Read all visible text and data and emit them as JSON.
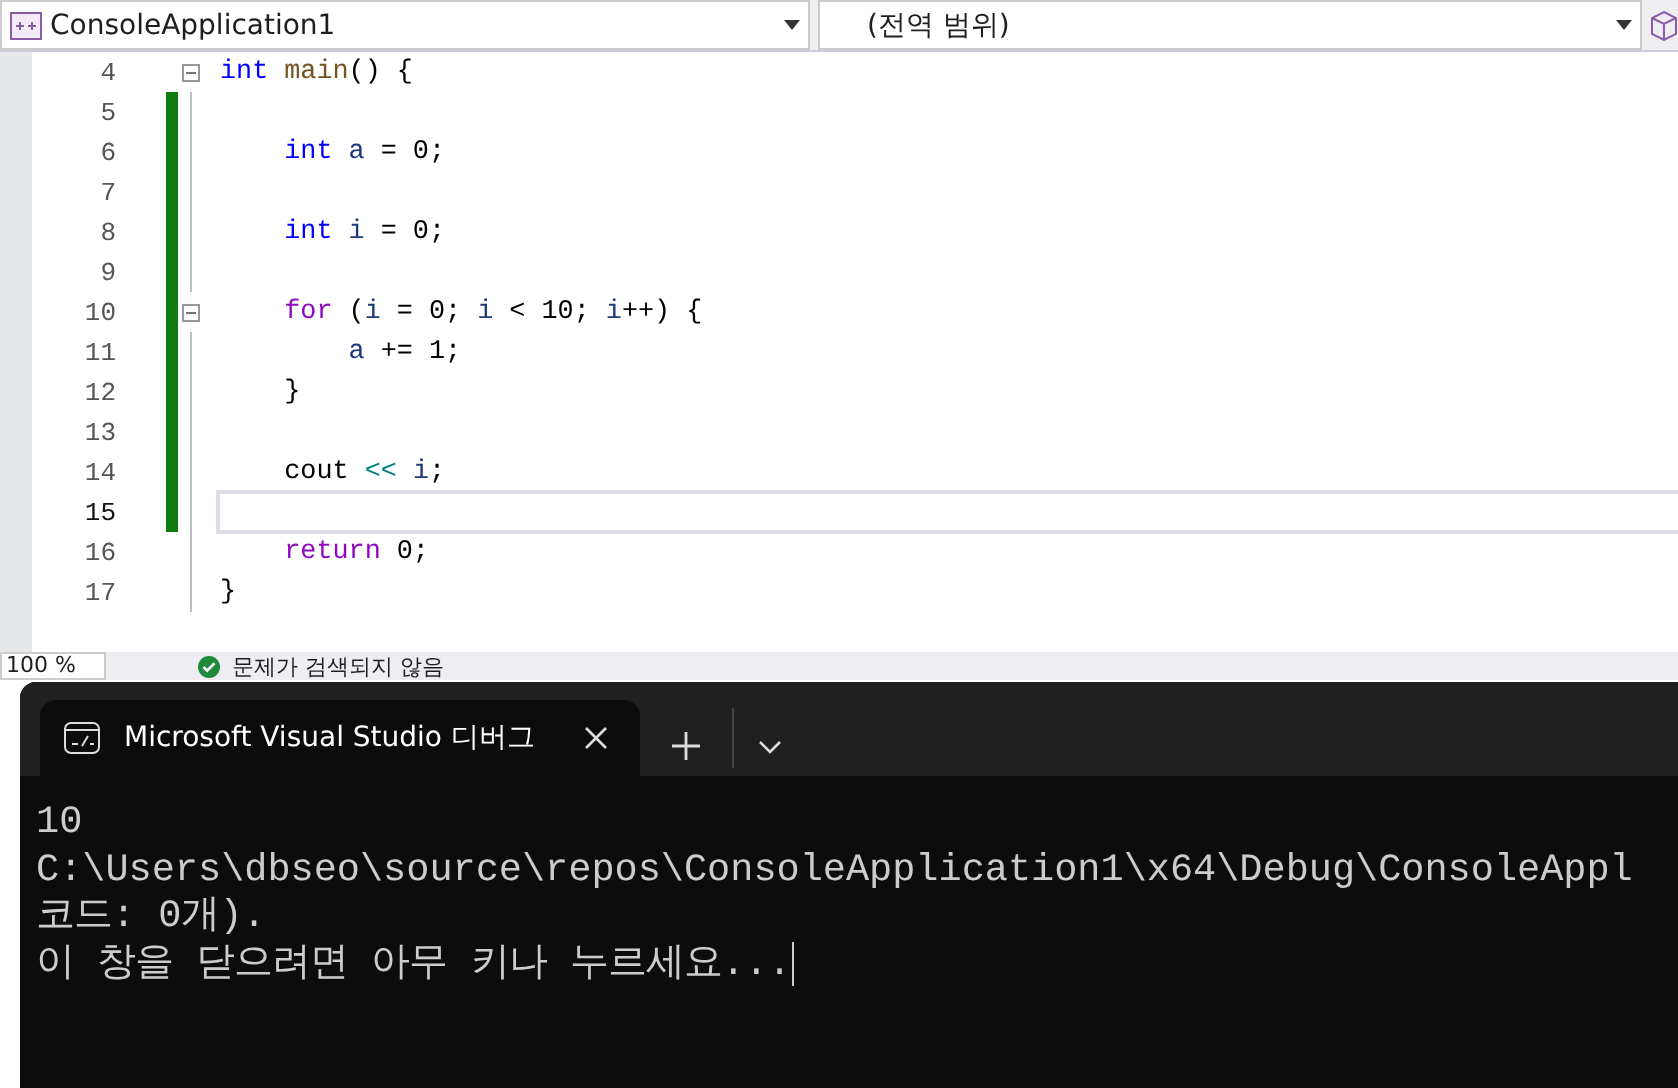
{
  "navbar": {
    "project": "ConsoleApplication1",
    "scope": "(전역 범위)"
  },
  "editor": {
    "lines": [
      {
        "number": "4",
        "changed": false,
        "current": false,
        "fold": true,
        "tokens": [
          {
            "text": "int",
            "kind": "keyword"
          },
          {
            "text": " main",
            "kind": "function"
          },
          {
            "text": "() {",
            "kind": "plain"
          }
        ]
      },
      {
        "number": "5",
        "changed": true,
        "current": false,
        "fold": false
      },
      {
        "number": "6",
        "changed": true,
        "current": false,
        "fold": false,
        "tokens": [
          {
            "text": "    int",
            "kind": "keyword"
          },
          {
            "text": " a",
            "kind": "variable"
          },
          {
            "text": " = 0;",
            "kind": "plain"
          }
        ]
      },
      {
        "number": "7",
        "changed": true,
        "current": false,
        "fold": false
      },
      {
        "number": "8",
        "changed": true,
        "current": false,
        "fold": false,
        "tokens": [
          {
            "text": "    int",
            "kind": "keyword"
          },
          {
            "text": " i",
            "kind": "variable"
          },
          {
            "text": " = 0;",
            "kind": "plain"
          }
        ]
      },
      {
        "number": "9",
        "changed": true,
        "current": false,
        "fold": false
      },
      {
        "number": "10",
        "changed": true,
        "current": false,
        "fold": true,
        "tokens": [
          {
            "text": "    for",
            "kind": "control"
          },
          {
            "text": " (",
            "kind": "plain"
          },
          {
            "text": "i",
            "kind": "variable"
          },
          {
            "text": " = 0; ",
            "kind": "plain"
          },
          {
            "text": "i",
            "kind": "variable"
          },
          {
            "text": " < 10; ",
            "kind": "plain"
          },
          {
            "text": "i",
            "kind": "variable"
          },
          {
            "text": "++) {",
            "kind": "plain"
          }
        ]
      },
      {
        "number": "11",
        "changed": true,
        "current": false,
        "fold": false,
        "tokens": [
          {
            "text": "        a",
            "kind": "variable"
          },
          {
            "text": " += 1;",
            "kind": "plain"
          }
        ]
      },
      {
        "number": "12",
        "changed": true,
        "current": false,
        "fold": false,
        "tokens": [
          {
            "text": "    }",
            "kind": "plain"
          }
        ]
      },
      {
        "number": "13",
        "changed": true,
        "current": false,
        "fold": false
      },
      {
        "number": "14",
        "changed": true,
        "current": false,
        "fold": false,
        "tokens": [
          {
            "text": "    cout ",
            "kind": "plain"
          },
          {
            "text": "<<",
            "kind": "operator"
          },
          {
            "text": " i",
            "kind": "variable"
          },
          {
            "text": ";",
            "kind": "plain"
          }
        ]
      },
      {
        "number": "15",
        "changed": true,
        "current": true,
        "fold": false
      },
      {
        "number": "16",
        "changed": false,
        "current": false,
        "fold": false,
        "tokens": [
          {
            "text": "    return",
            "kind": "control"
          },
          {
            "text": " 0;",
            "kind": "plain"
          }
        ]
      },
      {
        "number": "17",
        "changed": false,
        "current": false,
        "fold": false,
        "tokens": [
          {
            "text": "}",
            "kind": "plain"
          }
        ]
      }
    ]
  },
  "status_bar": {
    "zoom": "100 %",
    "issues": "문제가 검색되지 않음"
  },
  "terminal": {
    "tab_title": "Microsoft Visual Studio 디버그",
    "tab_selected": true,
    "output": [
      "10",
      "C:\\Users\\dbseo\\source\\repos\\ConsoleApplication1\\x64\\Debug\\ConsoleAppl",
      "코드: 0개).",
      "이 창을 닫으려면 아무 키나 누르세요..."
    ]
  }
}
